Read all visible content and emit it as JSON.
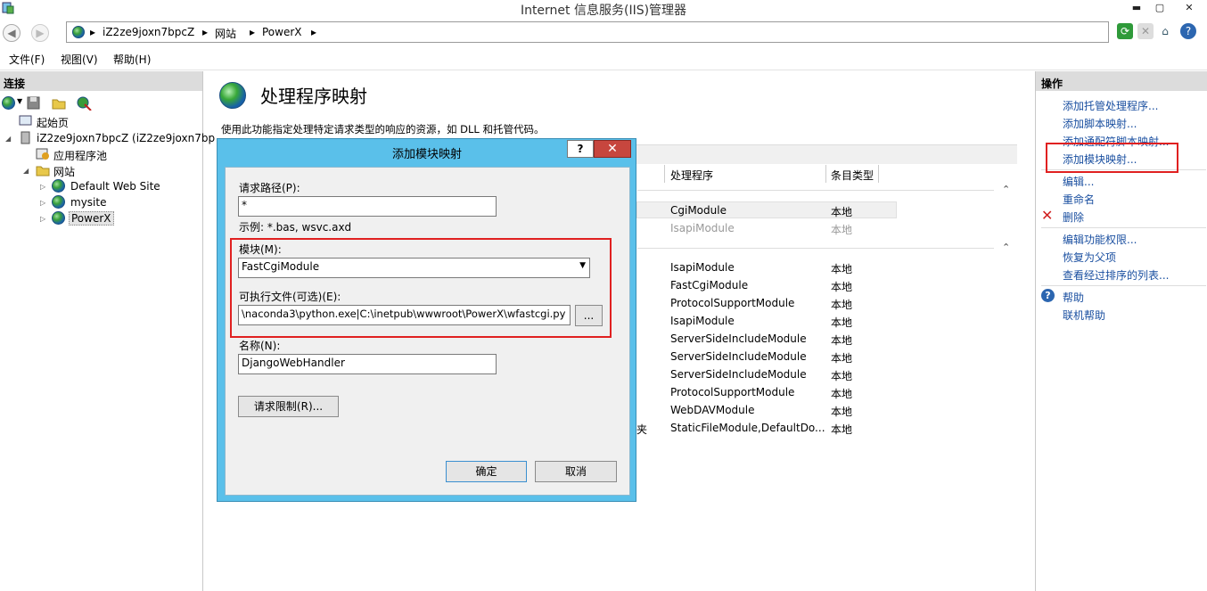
{
  "window": {
    "title": "Internet 信息服务(IIS)管理器",
    "min": "▬",
    "max": "▢",
    "close": "✕"
  },
  "address": {
    "crumbs": [
      "iZ2ze9joxn7bpcZ",
      "网站",
      "PowerX"
    ],
    "separator": "▸"
  },
  "toolbar_icons": [
    "refresh-icon",
    "stop-icon",
    "home-icon",
    "help-icon"
  ],
  "menu": [
    "文件(F)",
    "视图(V)",
    "帮助(H)"
  ],
  "left": {
    "header": "连接",
    "tree": {
      "start_page": "起始页",
      "server": "iZ2ze9joxn7bpcZ (iZ2ze9joxn7bp",
      "app_pools": "应用程序池",
      "sites": "网站",
      "site1": "Default Web Site",
      "site2": "mysite",
      "site3": "PowerX"
    }
  },
  "center": {
    "title": "处理程序映射",
    "description": "使用此功能指定处理特定请求类型的响应的资源，如 DLL 和托管代码。",
    "col_handler": "处理程序",
    "col_entry_type": "条目类型",
    "group1": [
      {
        "handler": "CgiModule",
        "type": "本地",
        "dim": false
      },
      {
        "handler": "IsapiModule",
        "type": "本地",
        "dim": true
      }
    ],
    "group2": [
      {
        "handler": "IsapiModule",
        "type": "本地"
      },
      {
        "handler": "FastCgiModule",
        "type": "本地"
      },
      {
        "handler": "ProtocolSupportModule",
        "type": "本地"
      },
      {
        "handler": "IsapiModule",
        "type": "本地"
      },
      {
        "handler": "ServerSideIncludeModule",
        "type": "本地"
      },
      {
        "handler": "ServerSideIncludeModule",
        "type": "本地"
      },
      {
        "handler": "ServerSideIncludeModule",
        "type": "本地"
      },
      {
        "handler": "ProtocolSupportModule",
        "type": "本地"
      },
      {
        "handler": "WebDAVModule",
        "type": "本地"
      },
      {
        "handler": "StaticFileModule,DefaultDo...",
        "type": "本地"
      }
    ],
    "partial_text": "夹"
  },
  "right": {
    "header": "操作",
    "actions": {
      "add_managed": "添加托管处理程序...",
      "add_script": "添加脚本映射...",
      "add_wildcard": "添加通配符脚本映射...",
      "add_module": "添加模块映射...",
      "edit": "编辑...",
      "rename": "重命名",
      "delete": "删除",
      "edit_perms": "编辑功能权限...",
      "revert": "恢复为父项",
      "view_ordered": "查看经过排序的列表...",
      "help": "帮助",
      "online_help": "联机帮助"
    }
  },
  "dialog": {
    "title": "添加模块映射",
    "help": "?",
    "close": "✕",
    "request_path_label": "请求路径(P):",
    "request_path_value": "*",
    "example": "示例: *.bas, wsvc.axd",
    "module_label": "模块(M):",
    "module_value": "FastCgiModule",
    "exe_label": "可执行文件(可选)(E):",
    "exe_value": "\\naconda3\\python.exe|C:\\inetpub\\wwwroot\\PowerX\\wfastcgi.py",
    "browse": "...",
    "name_label": "名称(N):",
    "name_value": "DjangoWebHandler",
    "restrictions": "请求限制(R)...",
    "ok": "确定",
    "cancel": "取消"
  },
  "colors": {
    "dialog_frame": "#5ac0ea",
    "highlight": "#e02020",
    "link": "#1a4fa0"
  }
}
